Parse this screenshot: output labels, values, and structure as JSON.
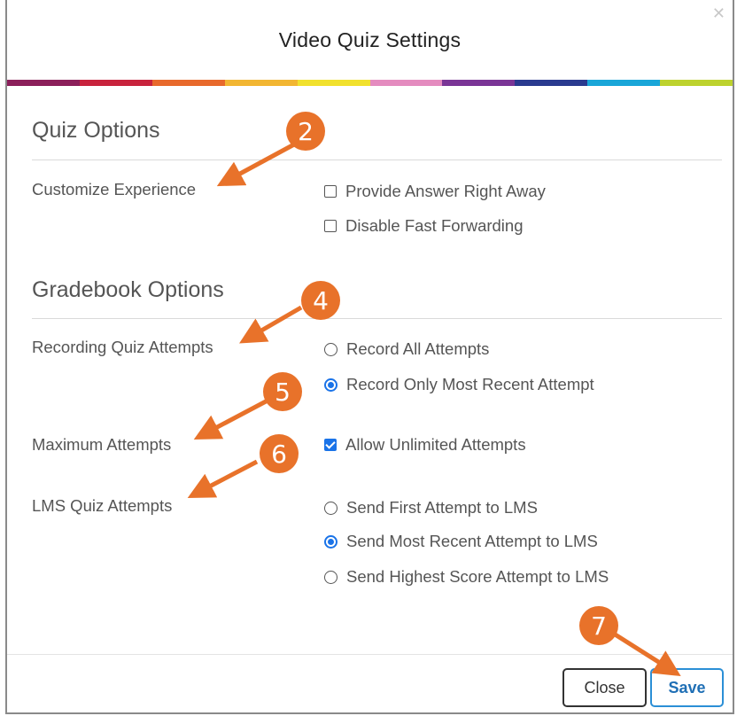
{
  "dialog": {
    "title": "Video Quiz Settings",
    "close_icon": "close-icon",
    "rainbow_colors": [
      "#8b1f5a",
      "#c8233d",
      "#e8692c",
      "#f2b632",
      "#f1e12e",
      "#e48bbf",
      "#7a3596",
      "#2a3a8f",
      "#1aa6d8",
      "#bdd22e"
    ]
  },
  "quiz_options": {
    "heading": "Quiz Options",
    "customize_label": "Customize Experience",
    "options": [
      {
        "label": "Provide Answer Right Away",
        "checked": false
      },
      {
        "label": "Disable Fast Forwarding",
        "checked": false
      }
    ]
  },
  "gradebook_options": {
    "heading": "Gradebook Options",
    "recording_label": "Recording Quiz Attempts",
    "recording_options": [
      {
        "label": "Record All Attempts",
        "selected": false
      },
      {
        "label": "Record Only Most Recent Attempt",
        "selected": true
      }
    ],
    "max_attempts_label": "Maximum Attempts",
    "max_attempts_option": {
      "label": "Allow Unlimited Attempts",
      "checked": true
    },
    "lms_label": "LMS Quiz Attempts",
    "lms_options": [
      {
        "label": "Send First Attempt to LMS",
        "selected": false
      },
      {
        "label": "Send Most Recent Attempt to LMS",
        "selected": true
      },
      {
        "label": "Send Highest Score Attempt to LMS",
        "selected": false
      }
    ]
  },
  "footer": {
    "close_label": "Close",
    "save_label": "Save"
  },
  "callouts": [
    "2",
    "4",
    "5",
    "6",
    "7"
  ],
  "colors": {
    "accent": "#1a73e8",
    "callout": "#e8722a"
  }
}
